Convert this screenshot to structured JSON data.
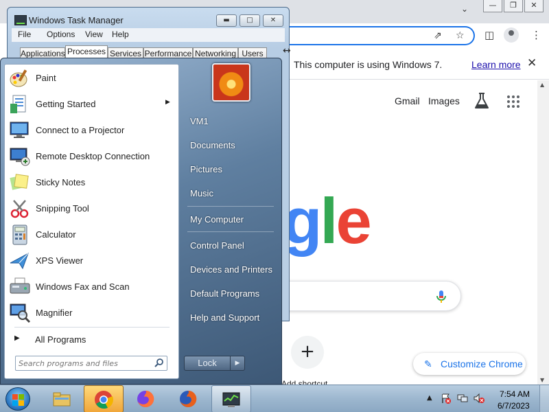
{
  "browser": {
    "tabs_dropdown_icon": "chevron-down-icon",
    "window_controls": [
      "minimize",
      "restore",
      "close"
    ],
    "toolbar_icons": [
      "share-icon",
      "star-icon",
      "side-panel-icon",
      "profile-icon",
      "more-icon"
    ],
    "infobar": {
      "message": "This computer is using Windows 7.",
      "link": "Learn more",
      "close_icon": "close-icon"
    },
    "header_links": {
      "gmail": "Gmail",
      "images": "Images"
    },
    "logo_text": "gle",
    "logo_colors": [
      "#4285f4",
      "#34a853",
      "#ea4335"
    ],
    "add_shortcut_symbol": "+",
    "add_shortcut_label": "Add shortcut",
    "customize_label": "Customize Chrome",
    "accent": "#1a73e8"
  },
  "task_manager": {
    "title": "Windows Task Manager",
    "menu": [
      "File",
      "Options",
      "View",
      "Help"
    ],
    "tabs": [
      "Applications",
      "Processes",
      "Services",
      "Performance",
      "Networking",
      "Users"
    ],
    "active_tab": "Processes"
  },
  "start_menu": {
    "programs": [
      {
        "label": "Paint",
        "icon": "paint-icon"
      },
      {
        "label": "Getting Started",
        "icon": "getting-started-icon",
        "submenu": true
      },
      {
        "label": "Connect to a Projector",
        "icon": "projector-icon"
      },
      {
        "label": "Remote Desktop Connection",
        "icon": "remote-desktop-icon"
      },
      {
        "label": "Sticky Notes",
        "icon": "sticky-notes-icon"
      },
      {
        "label": "Snipping Tool",
        "icon": "snipping-tool-icon"
      },
      {
        "label": "Calculator",
        "icon": "calculator-icon"
      },
      {
        "label": "XPS Viewer",
        "icon": "xps-viewer-icon"
      },
      {
        "label": "Windows Fax and Scan",
        "icon": "fax-scan-icon"
      },
      {
        "label": "Magnifier",
        "icon": "magnifier-icon"
      }
    ],
    "all_programs": "All Programs",
    "search_placeholder": "Search programs and files",
    "right_links": [
      "VM1",
      "Documents",
      "Pictures",
      "Music",
      "My Computer",
      "Control Panel",
      "Devices and Printers",
      "Default Programs",
      "Help and Support"
    ],
    "lock_label": "Lock"
  },
  "taskbar": {
    "pinned": [
      "windows-explorer-icon",
      "chrome-icon",
      "firefox-icon",
      "firefox-icon",
      "task-manager-icon"
    ],
    "active": "chrome-icon",
    "tray_icons": [
      "action-center-icon",
      "network-icon",
      "volume-muted-icon"
    ],
    "time": "7:54 AM",
    "date": "6/7/2023"
  }
}
